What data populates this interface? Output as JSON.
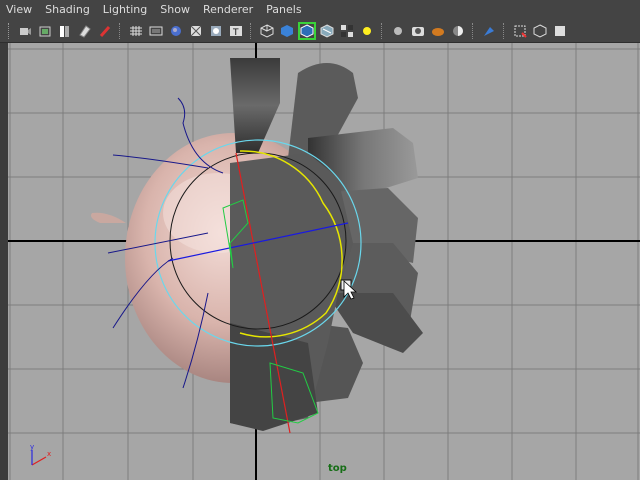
{
  "menus": [
    {
      "label": "View"
    },
    {
      "label": "Shading"
    },
    {
      "label": "Lighting"
    },
    {
      "label": "Show"
    },
    {
      "label": "Renderer"
    },
    {
      "label": "Panels"
    }
  ],
  "toolbar": {
    "groups": [
      [
        "select-camera",
        "camera-attributes",
        "bookmarks",
        "image-plane",
        "grease-pencil"
      ],
      [
        "grid",
        "film-gate",
        "resolution-gate",
        "gate-mask",
        "field-chart",
        "safe-title"
      ],
      [
        "wireframe",
        "smooth-shade",
        "wireframe-on-shaded",
        "textured",
        "use-all-lights",
        "default-light"
      ],
      [
        "shadows",
        "screen-space-ao",
        "motion-blur",
        "anti-alias"
      ],
      [
        "isolate-select"
      ],
      [
        "xray",
        "xray-joints",
        "xray-active"
      ]
    ]
  },
  "viewport": {
    "camera": "top",
    "background": "#a6a6a6",
    "grid_color": "#7d7d7d",
    "axis_color": "#000000",
    "manipulator": {
      "outer_ring_color": "#6ad7ec",
      "yellow_ring_color": "#e6e600",
      "red_axis_color": "#e02020",
      "blue_axis_color": "#1a1ae0",
      "green_axis_color": "#22cc44"
    },
    "axis_indicator": {
      "x": "x",
      "y": "y"
    }
  }
}
